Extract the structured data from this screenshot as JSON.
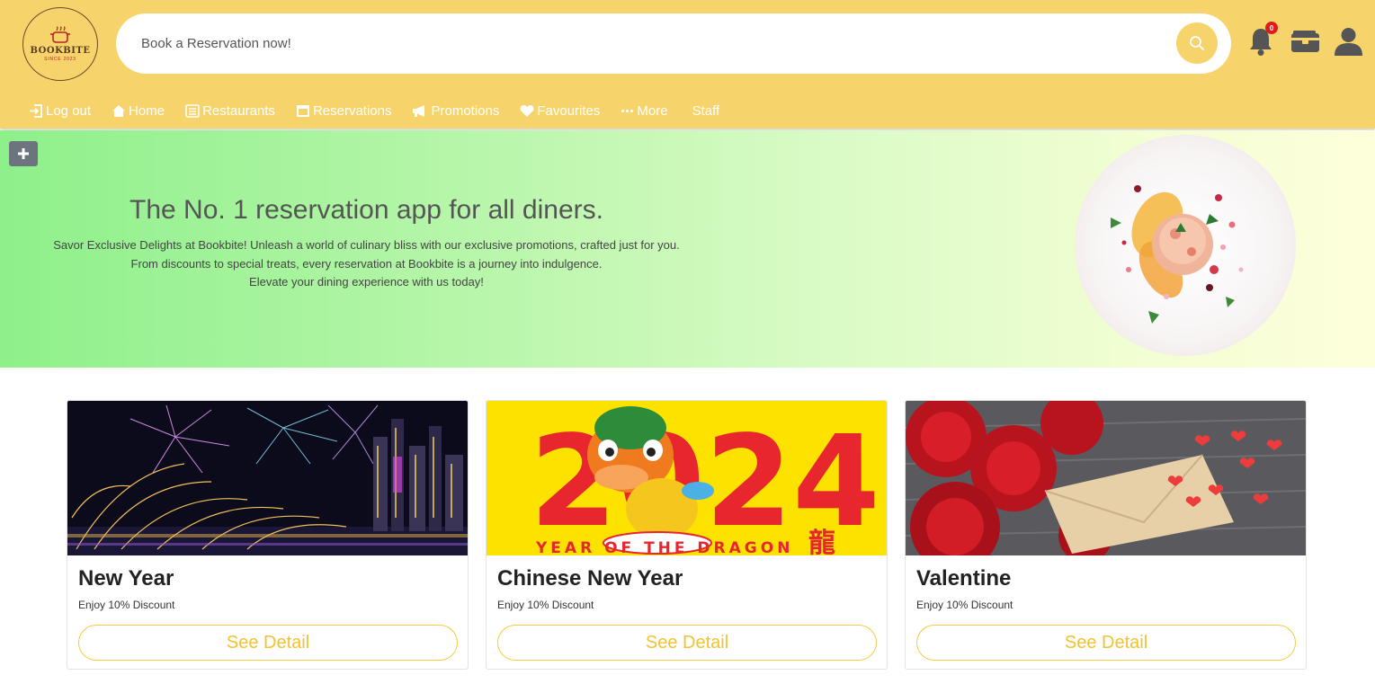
{
  "header": {
    "logo": {
      "brand": "BOOKBITE",
      "since": "SINCE 2023"
    },
    "search": {
      "placeholder": "Book a Reservation now!"
    },
    "notifications": {
      "count": "0"
    },
    "icons": [
      "bell-icon",
      "wallet-icon",
      "user-icon"
    ],
    "colors": {
      "header_bg": "#f7d46b",
      "badge": "#e01b1b"
    }
  },
  "nav": {
    "items": [
      {
        "label": "Log out",
        "icon": "logout-icon"
      },
      {
        "label": "Home",
        "icon": "home-icon"
      },
      {
        "label": "Restaurants",
        "icon": "list-icon"
      },
      {
        "label": "Reservations",
        "icon": "calendar-icon"
      },
      {
        "label": "Promotions",
        "icon": "megaphone-icon"
      },
      {
        "label": "Favourites",
        "icon": "heart-icon"
      },
      {
        "label": "More",
        "icon": "ellipsis-icon"
      },
      {
        "label": "Staff",
        "icon": ""
      }
    ]
  },
  "hero": {
    "title": "The No. 1 reservation app for all diners.",
    "lines": [
      "Savor Exclusive Delights at Bookbite! Unleash a world of culinary bliss with our exclusive promotions, crafted just for you.",
      "From discounts to special treats, every reservation at Bookbite is a journey into indulgence.",
      "Elevate your dining experience with us today!"
    ]
  },
  "promotions": [
    {
      "title": "New Year",
      "subtitle": "Enjoy 10% Discount",
      "button": "See Detail"
    },
    {
      "title": "Chinese New Year",
      "subtitle": "Enjoy 10% Discount",
      "button": "See Detail",
      "image_text": {
        "year": "2024",
        "caption": "YEAR OF THE DRAGON",
        "glyph": "龍"
      }
    },
    {
      "title": "Valentine",
      "subtitle": "Enjoy 10% Discount",
      "button": "See Detail"
    }
  ],
  "accent_color": "#f3cb44"
}
